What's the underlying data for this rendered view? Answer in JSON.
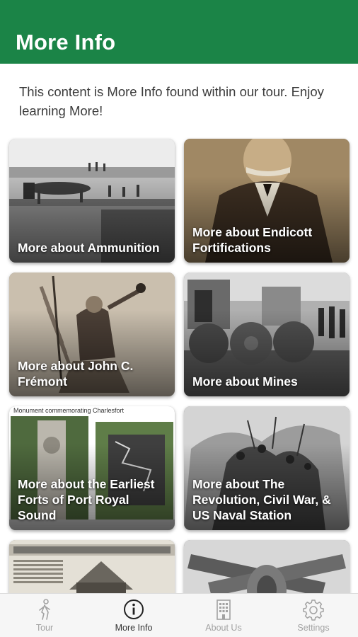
{
  "header": {
    "title": "More Info"
  },
  "intro": {
    "text": "This content is More Info found within our tour. Enjoy learning More!"
  },
  "cards": [
    {
      "title": "More about Ammunition",
      "icon": "fort-cannon-photo"
    },
    {
      "title": "More about Endicott Fortifications",
      "icon": "portrait-photo"
    },
    {
      "title": "More about John C. Frémont",
      "icon": "flag-engraving-photo"
    },
    {
      "title": "More about Mines",
      "icon": "naval-mines-photo"
    },
    {
      "title": "More about the Earliest Forts of Port Royal Sound",
      "caption": "Monument commemorating Charlesfort",
      "icon": "monument-photo"
    },
    {
      "title": "More about The Revolution, Civil War, & US Naval Station",
      "icon": "battle-engraving-photo"
    },
    {
      "title": "",
      "icon": "newspaper-photo"
    },
    {
      "title": "",
      "icon": "crossed-cannons-photo"
    }
  ],
  "nav": [
    {
      "label": "Tour",
      "icon": "walking-person-icon",
      "active": false
    },
    {
      "label": "More Info",
      "icon": "info-icon",
      "active": true
    },
    {
      "label": "About Us",
      "icon": "building-icon",
      "active": false
    },
    {
      "label": "Settings",
      "icon": "gear-icon",
      "active": false
    }
  ],
  "colors": {
    "header": "#1b8447",
    "nav_active": "#333333",
    "nav_inactive": "#a2a2a2"
  }
}
